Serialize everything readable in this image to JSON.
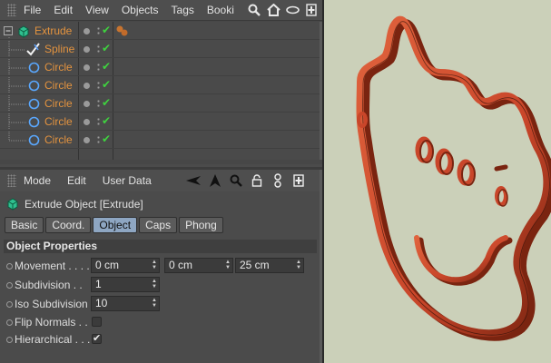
{
  "object_manager": {
    "menu": [
      "File",
      "Edit",
      "View",
      "Objects",
      "Tags",
      "Booki"
    ],
    "tools": [
      "search-icon",
      "home-icon",
      "eye-icon",
      "expand-icon"
    ],
    "objects": [
      {
        "name": "Extrude",
        "icon": "extrude-icon",
        "level": 0,
        "tag": "material-tag-icon"
      },
      {
        "name": "Spline",
        "icon": "spline-icon",
        "level": 1
      },
      {
        "name": "Circle",
        "icon": "circle-icon",
        "level": 1
      },
      {
        "name": "Circle",
        "icon": "circle-icon",
        "level": 1
      },
      {
        "name": "Circle",
        "icon": "circle-icon",
        "level": 1
      },
      {
        "name": "Circle",
        "icon": "circle-icon",
        "level": 1
      },
      {
        "name": "Circle",
        "icon": "circle-icon",
        "level": 1
      }
    ],
    "check_mark": "✔"
  },
  "attribute_manager": {
    "menu": [
      "Mode",
      "Edit",
      "User Data"
    ],
    "tools": [
      "back-arrow-icon",
      "pointer-icon",
      "search-icon",
      "lock-icon",
      "link-icon",
      "expand-icon"
    ],
    "title": "Extrude Object [Extrude]",
    "tabs": [
      "Basic",
      "Coord.",
      "Object",
      "Caps",
      "Phong"
    ],
    "active_tab": "Object",
    "section_title": "Object Properties",
    "properties": {
      "movement": {
        "label": "Movement . . . .",
        "values": [
          "0 cm",
          "0 cm",
          "25 cm"
        ]
      },
      "subdivision": {
        "label": "Subdivision  . .",
        "value": "1"
      },
      "iso_subdivision": {
        "label": "Iso Subdivision",
        "value": "10"
      },
      "flip_normals": {
        "label": "Flip Normals  . .",
        "checked": false
      },
      "hierarchical": {
        "label": "Hierarchical . . .",
        "checked": true,
        "mark": "✔"
      }
    }
  },
  "viewport": {
    "background": "#cbd0b9",
    "ribbon_color": "#d4512f",
    "ribbon_dark": "#8a2e17"
  }
}
